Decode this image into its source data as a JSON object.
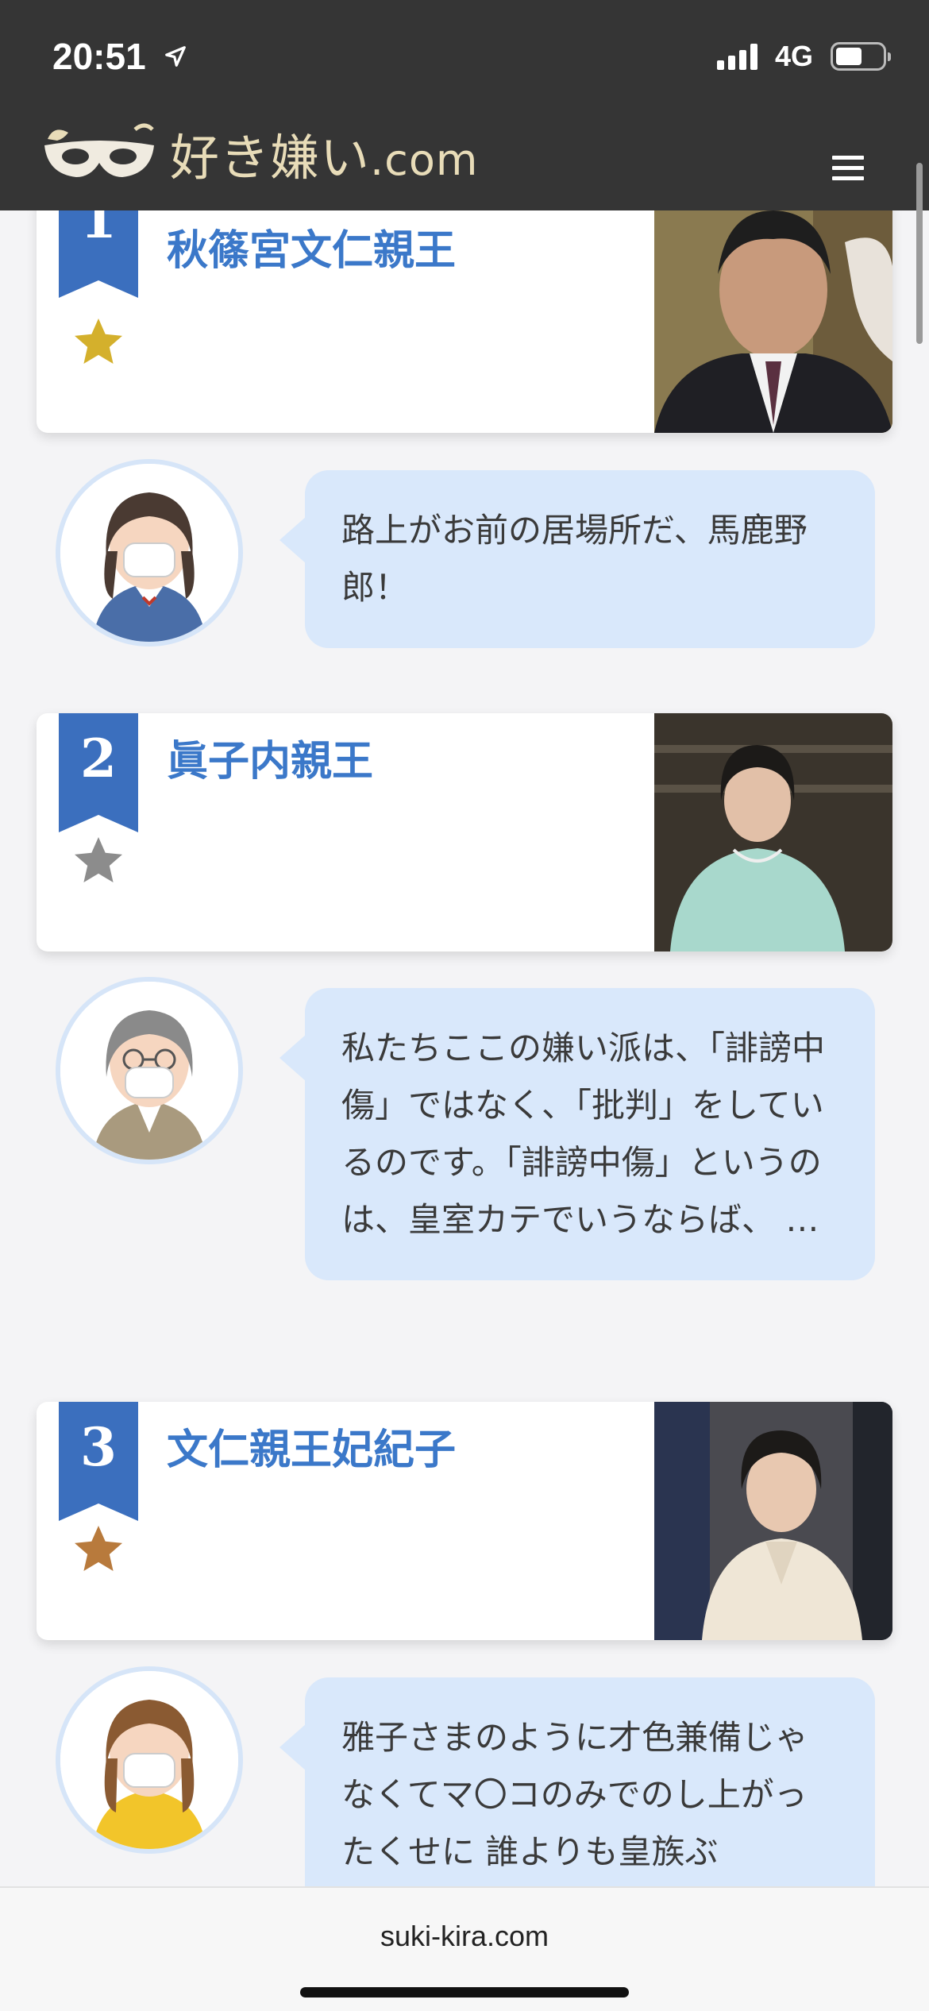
{
  "status": {
    "time": "20:51",
    "network": "4G",
    "battery_level": 0.5
  },
  "header": {
    "logo_title": "好き嫌い",
    "logo_domain": ".com"
  },
  "rankings": [
    {
      "rank": "1",
      "name": "秋篠宮文仁親王",
      "star_color": "#d4b02c",
      "photo_label": "rank-1-photo"
    },
    {
      "rank": "2",
      "name": "眞子内親王",
      "star_color": "#8c8c8c",
      "photo_label": "rank-2-photo"
    },
    {
      "rank": "3",
      "name": "文仁親王妃紀子",
      "star_color": "#b87a3c",
      "photo_label": "rank-3-photo"
    }
  ],
  "comments": [
    {
      "text": "路上がお前の居場所だ、馬鹿野郎！"
    },
    {
      "text": "私たちここの嫌い派は、「誹謗中傷」ではなく、「批判」をしているのです。「誹謗中傷」というのは、皇室カテでいうならば、 …"
    },
    {
      "text": "雅子さまのように才色兼備じゃなくてマ〇コのみでのし上がったくせに 誰よりも皇族ぶ"
    }
  ],
  "browser": {
    "url": "suki-kira.com"
  },
  "colors": {
    "ribbon": "#3b6fbe",
    "accent_text": "#3b78c9",
    "bubble": "#d9e8fb",
    "header_bg": "#353535"
  }
}
